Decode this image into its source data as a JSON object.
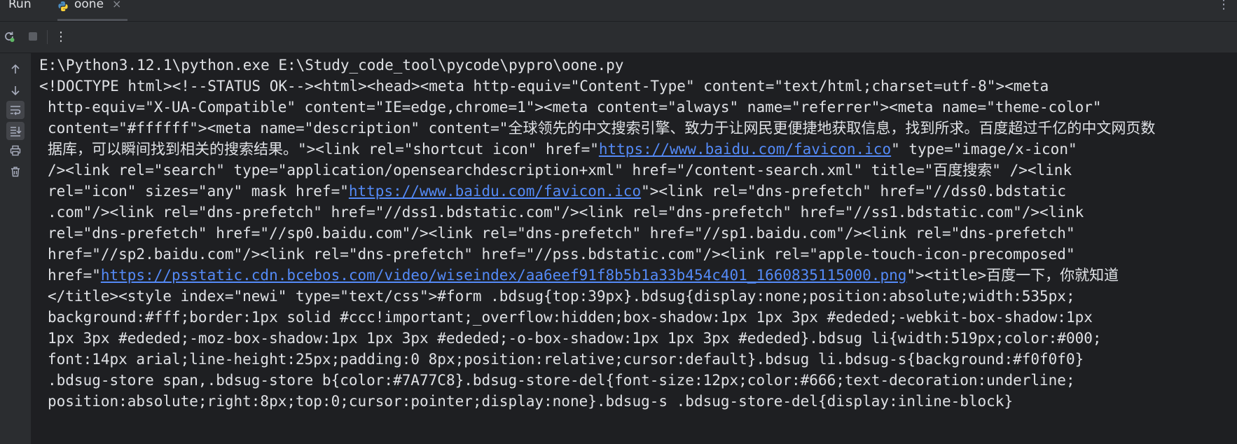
{
  "tool_window": {
    "title": "Run",
    "tab": {
      "label": "oone",
      "close": "×"
    },
    "more_glyph": "⋮"
  },
  "toolbar": {
    "rerun_icon": "rerun-icon",
    "stop_icon": "stop-icon",
    "more_glyph": "⋮"
  },
  "gutter": {
    "icons": [
      "arrow-up-icon",
      "arrow-down-icon",
      "soft-wrap-icon",
      "scroll-to-end-icon",
      "print-icon",
      "trash-icon"
    ]
  },
  "console": {
    "lines": [
      {
        "indent": false,
        "parts": [
          {
            "t": "E:\\Python3.12.1\\python.exe E:\\Study_code_tool\\pycode\\pypro\\oone.py"
          }
        ]
      },
      {
        "indent": false,
        "parts": [
          {
            "t": "<!DOCTYPE html><!--STATUS OK--><html><head><meta http-equiv=\"Content-Type\" content=\"text/html;charset=utf-8\"><meta"
          }
        ]
      },
      {
        "indent": true,
        "parts": [
          {
            "t": "http-equiv=\"X-UA-Compatible\" content=\"IE=edge,chrome=1\"><meta content=\"always\" name=\"referrer\"><meta name=\"theme-color\""
          }
        ]
      },
      {
        "indent": true,
        "parts": [
          {
            "t": "content=\"#ffffff\"><meta name=\"description\" content=\"全球领先的中文搜索引擎、致力于让网民更便捷地获取信息，找到所求。百度超过千亿的中文网页数"
          }
        ]
      },
      {
        "indent": true,
        "parts": [
          {
            "t": "据库，可以瞬间找到相关的搜索结果。\"><link rel=\"shortcut icon\" href=\""
          },
          {
            "t": "https://www.baidu.com/favicon.ico",
            "link": true
          },
          {
            "t": "\" type=\"image/x-icon\""
          }
        ]
      },
      {
        "indent": true,
        "parts": [
          {
            "t": "/><link rel=\"search\" type=\"application/opensearchdescription+xml\" href=\"/content-search.xml\" title=\"百度搜索\" /><link"
          }
        ]
      },
      {
        "indent": true,
        "parts": [
          {
            "t": "rel=\"icon\" sizes=\"any\" mask href=\""
          },
          {
            "t": "https://www.baidu.com/favicon.ico",
            "link": true
          },
          {
            "t": "\"><link rel=\"dns-prefetch\" href=\"//dss0.bdstatic"
          }
        ]
      },
      {
        "indent": true,
        "parts": [
          {
            "t": ".com\"/><link rel=\"dns-prefetch\" href=\"//dss1.bdstatic.com\"/><link rel=\"dns-prefetch\" href=\"//ss1.bdstatic.com\"/><link"
          }
        ]
      },
      {
        "indent": true,
        "parts": [
          {
            "t": "rel=\"dns-prefetch\" href=\"//sp0.baidu.com\"/><link rel=\"dns-prefetch\" href=\"//sp1.baidu.com\"/><link rel=\"dns-prefetch\""
          }
        ]
      },
      {
        "indent": true,
        "parts": [
          {
            "t": "href=\"//sp2.baidu.com\"/><link rel=\"dns-prefetch\" href=\"//pss.bdstatic.com\"/><link rel=\"apple-touch-icon-precomposed\""
          }
        ]
      },
      {
        "indent": true,
        "parts": [
          {
            "t": "href=\""
          },
          {
            "t": "https://psstatic.cdn.bcebos.com/video/wiseindex/aa6eef91f8b5b1a33b454c401_1660835115000.png",
            "link": true
          },
          {
            "t": "\"><title>百度一下，你就知道"
          }
        ]
      },
      {
        "indent": true,
        "parts": [
          {
            "t": "</title><style index=\"newi\" type=\"text/css\">#form .bdsug{top:39px}.bdsug{display:none;position:absolute;width:535px;"
          }
        ]
      },
      {
        "indent": true,
        "parts": [
          {
            "t": "background:#fff;border:1px solid #ccc!important;_overflow:hidden;box-shadow:1px 1px 3px #ededed;-webkit-box-shadow:1px"
          }
        ]
      },
      {
        "indent": true,
        "parts": [
          {
            "t": "1px 3px #ededed;-moz-box-shadow:1px 1px 3px #ededed;-o-box-shadow:1px 1px 3px #ededed}.bdsug li{width:519px;color:#000;"
          }
        ]
      },
      {
        "indent": true,
        "parts": [
          {
            "t": "font:14px arial;line-height:25px;padding:0 8px;position:relative;cursor:default}.bdsug li.bdsug-s{background:#f0f0f0}"
          }
        ]
      },
      {
        "indent": true,
        "parts": [
          {
            "t": ".bdsug-store span,.bdsug-store b{color:#7A77C8}.bdsug-store-del{font-size:12px;color:#666;text-decoration:underline;"
          }
        ]
      },
      {
        "indent": true,
        "parts": [
          {
            "t": "position:absolute;right:8px;top:0;cursor:pointer;display:none}.bdsug-s .bdsug-store-del{display:inline-block}"
          }
        ]
      }
    ]
  },
  "colors": {
    "panel_bg": "#2b2d30",
    "console_bg": "#1e1f22",
    "text": "#dfe1e5",
    "link": "#548af7",
    "rerun_green": "#5fb865"
  }
}
